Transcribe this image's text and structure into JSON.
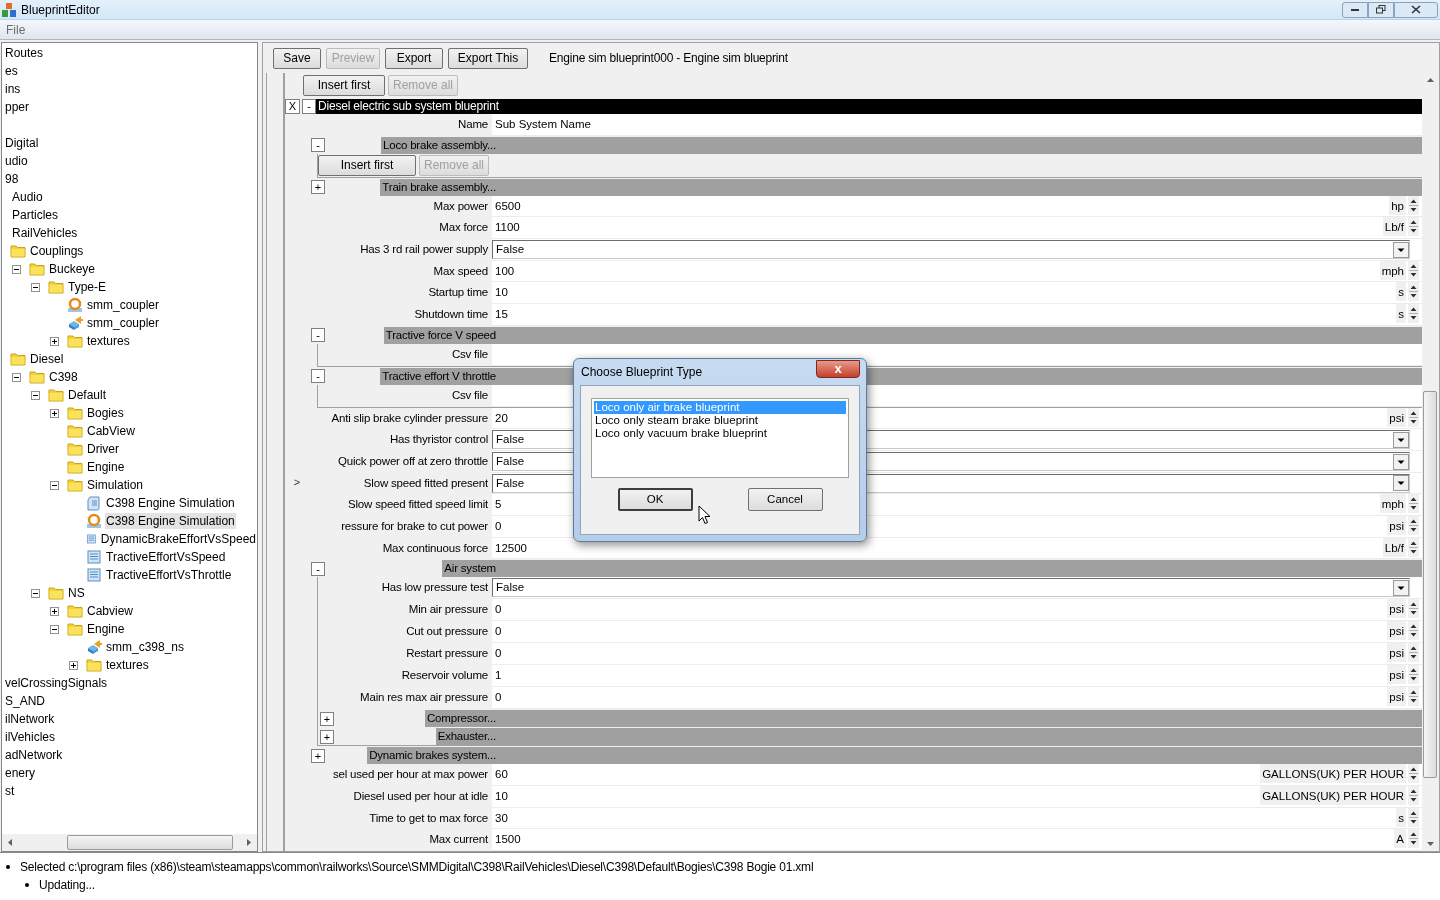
{
  "window": {
    "title": "BlueprintEditor"
  },
  "menu": [
    {
      "label": "File",
      "disabled": true
    }
  ],
  "tree": [
    {
      "label": "Routes",
      "selected": false
    },
    {
      "label": "es",
      "selected": false
    },
    {
      "label": "ins",
      "selected": false
    },
    {
      "label": "pper",
      "selected": false
    },
    {
      "label": "Digital",
      "selected": false
    },
    {
      "label": "udio",
      "selected": false
    },
    {
      "label": "98",
      "selected": false,
      "children": [
        {
          "label": "Audio",
          "selected": false
        },
        {
          "label": "Particles",
          "selected": false
        },
        {
          "label": "RailVehicles",
          "selected": false,
          "children": [
            {
              "label": "Couplings",
              "kind": "folder",
              "selected": false,
              "children": [
                {
                  "label": "Buckeye",
                  "kind": "folder",
                  "selected": false,
                  "expanded": true,
                  "children": [
                    {
                      "label": "Type-E",
                      "kind": "folder",
                      "selected": false,
                      "expanded": true,
                      "children": [
                        {
                          "label": "smm_coupler",
                          "kind": "blueprint",
                          "selected": false
                        },
                        {
                          "label": "smm_coupler",
                          "kind": "model",
                          "selected": false
                        },
                        {
                          "label": "textures",
                          "kind": "folder",
                          "selected": false,
                          "expanded": false
                        }
                      ]
                    }
                  ]
                }
              ]
            },
            {
              "label": "Diesel",
              "kind": "folder",
              "selected": false,
              "children": [
                {
                  "label": "C398",
                  "kind": "folder",
                  "selected": false,
                  "expanded": true,
                  "children": [
                    {
                      "label": "Default",
                      "kind": "folder",
                      "selected": false,
                      "expanded": true,
                      "children": [
                        {
                          "label": "Bogies",
                          "kind": "folder",
                          "selected": false,
                          "expanded": false
                        },
                        {
                          "label": "CabView",
                          "kind": "folder",
                          "selected": false
                        },
                        {
                          "label": "Driver",
                          "kind": "folder",
                          "selected": false
                        },
                        {
                          "label": "Engine",
                          "kind": "folder",
                          "selected": false
                        },
                        {
                          "label": "Simulation",
                          "kind": "folder",
                          "selected": false,
                          "expanded": true,
                          "children": [
                            {
                              "label": "C398 Engine Simulation",
                              "kind": "script",
                              "selected": false
                            },
                            {
                              "label": "C398 Engine Simulation",
                              "kind": "blueprint",
                              "selected": true
                            },
                            {
                              "label": "DynamicBrakeEffortVsSpeed",
                              "kind": "table",
                              "selected": false
                            },
                            {
                              "label": "TractiveEffortVsSpeed",
                              "kind": "table",
                              "selected": false
                            },
                            {
                              "label": "TractiveEffortVsThrottle",
                              "kind": "table",
                              "selected": false
                            }
                          ]
                        }
                      ]
                    },
                    {
                      "label": "NS",
                      "kind": "folder",
                      "selected": false,
                      "expanded": true,
                      "children": [
                        {
                          "label": "Cabview",
                          "kind": "folder",
                          "selected": false,
                          "expanded": false
                        },
                        {
                          "label": "Engine",
                          "kind": "folder",
                          "selected": false,
                          "expanded": true,
                          "children": [
                            {
                              "label": "smm_c398_ns",
                              "kind": "model",
                              "selected": false
                            },
                            {
                              "label": "textures",
                              "kind": "folder",
                              "selected": false,
                              "expanded": false
                            }
                          ]
                        }
                      ]
                    }
                  ]
                }
              ]
            }
          ]
        }
      ]
    },
    {
      "label": "velCrossingSignals",
      "selected": false
    },
    {
      "label": "S_AND",
      "selected": false
    },
    {
      "label": "ilNetwork",
      "selected": false
    },
    {
      "label": "ilVehicles",
      "selected": false
    },
    {
      "label": "adNetwork",
      "selected": false
    },
    {
      "label": "enery",
      "selected": false
    },
    {
      "label": "st",
      "selected": false
    }
  ],
  "toolbar": {
    "buttons": [
      {
        "label": "Save",
        "disabled": false
      },
      {
        "label": "Preview",
        "disabled": true
      },
      {
        "label": "Export",
        "disabled": false
      },
      {
        "label": "Export This",
        "disabled": false
      }
    ],
    "title": "Engine sim blueprint000 - Engine sim blueprint"
  },
  "form": {
    "top_buttons": [
      {
        "label": "Insert first",
        "disabled": false
      },
      {
        "label": "Remove all",
        "disabled": true
      }
    ],
    "side_toggle": ">",
    "blueprint": {
      "close": "X",
      "toggle": "-",
      "title": "Diesel electric sub system blueprint",
      "rows": [
        {
          "kind": "text",
          "label": "Name",
          "value": "Sub System Name"
        },
        {
          "kind": "section",
          "toggle": "-",
          "title": "Loco brake assembly...",
          "children": [
            {
              "kind": "buttons",
              "buttons": [
                {
                  "label": "Insert first",
                  "disabled": false
                },
                {
                  "label": "Remove all",
                  "disabled": true
                }
              ]
            }
          ]
        },
        {
          "kind": "section",
          "toggle": "+",
          "title": "Train brake assembly..."
        },
        {
          "kind": "number",
          "label": "Max power",
          "value": "6500",
          "unit": "hp"
        },
        {
          "kind": "number",
          "label": "Max force",
          "value": "1100",
          "unit": "Lb/f"
        },
        {
          "kind": "dropdown",
          "label": "Has 3 rd rail power supply",
          "value": "False"
        },
        {
          "kind": "number",
          "label": "Max speed",
          "value": "100",
          "unit": "mph"
        },
        {
          "kind": "number",
          "label": "Startup time",
          "value": "10",
          "unit": "s"
        },
        {
          "kind": "number",
          "label": "Shutdown time",
          "value": "15",
          "unit": "s"
        },
        {
          "kind": "section",
          "toggle": "-",
          "title": "Tractive force V speed",
          "children": [
            {
              "kind": "text",
              "label": "Csv file"
            }
          ]
        },
        {
          "kind": "section",
          "toggle": "-",
          "title": "Tractive effort V throttle",
          "children": [
            {
              "kind": "text",
              "label": "Csv file"
            }
          ]
        },
        {
          "kind": "number",
          "label": "Anti slip brake cylinder pressure",
          "value": "20",
          "unit": "psi"
        },
        {
          "kind": "dropdown",
          "label": "Has thyristor control",
          "value": "False"
        },
        {
          "kind": "dropdown",
          "label": "Quick power off at zero throttle",
          "value": "False"
        },
        {
          "kind": "dropdown",
          "label": "Slow speed fitted present",
          "value": "False"
        },
        {
          "kind": "number",
          "label": "Slow speed fitted speed limit",
          "value": "5",
          "unit": "mph"
        },
        {
          "kind": "number",
          "label": "ressure for brake to cut power",
          "value": "0",
          "unit": "psi"
        },
        {
          "kind": "number",
          "label": "Max continuous force",
          "value": "12500",
          "unit": "Lb/f"
        },
        {
          "kind": "section",
          "toggle": "-",
          "title": "Air system",
          "children": [
            {
              "kind": "dropdown",
              "label": "Has low pressure test",
              "value": "False"
            },
            {
              "kind": "number",
              "label": "Min air pressure",
              "value": "0",
              "unit": "psi"
            },
            {
              "kind": "number",
              "label": "Cut out pressure",
              "value": "0",
              "unit": "psi"
            },
            {
              "kind": "number",
              "label": "Restart pressure",
              "value": "0",
              "unit": "psi"
            },
            {
              "kind": "number",
              "label": "Reservoir volume",
              "value": "1",
              "unit": "psi"
            },
            {
              "kind": "number",
              "label": "Main res max air pressure",
              "value": "0",
              "unit": "psi"
            },
            {
              "kind": "section",
              "toggle": "+",
              "title": "Compressor..."
            },
            {
              "kind": "section",
              "toggle": "+",
              "title": "Exhauster..."
            }
          ]
        },
        {
          "kind": "section",
          "toggle": "+",
          "title": "Dynamic brakes system..."
        },
        {
          "kind": "number",
          "label": "sel used per hour at max power",
          "value": "60",
          "unit": "GALLONS(UK) PER HOUR"
        },
        {
          "kind": "number",
          "label": "Diesel used per hour at idle",
          "value": "10",
          "unit": "GALLONS(UK) PER HOUR"
        },
        {
          "kind": "number",
          "label": "Time to get to max force",
          "value": "30",
          "unit": "s"
        },
        {
          "kind": "number",
          "label": "Max current",
          "value": "1500",
          "unit": "A"
        }
      ]
    }
  },
  "dialog": {
    "title": "Choose Blueprint Type",
    "close": "x",
    "options": [
      {
        "label": "Loco only air brake blueprint",
        "selected": true
      },
      {
        "label": "Loco only steam brake blueprint",
        "selected": false
      },
      {
        "label": "Loco only vacuum brake blueprint",
        "selected": false
      }
    ],
    "buttons": [
      {
        "label": "OK",
        "focused": true
      },
      {
        "label": "Cancel",
        "focused": false
      }
    ]
  },
  "log": [
    {
      "text": "Selected c:\\program files (x86)\\steam\\steamapps\\common\\railworks\\Source\\SMMDigital\\C398\\RailVehicles\\Diesel\\C398\\Default\\Bogies\\C398 Bogie 01.xml",
      "children": [
        {
          "text": "Updating..."
        }
      ]
    }
  ]
}
